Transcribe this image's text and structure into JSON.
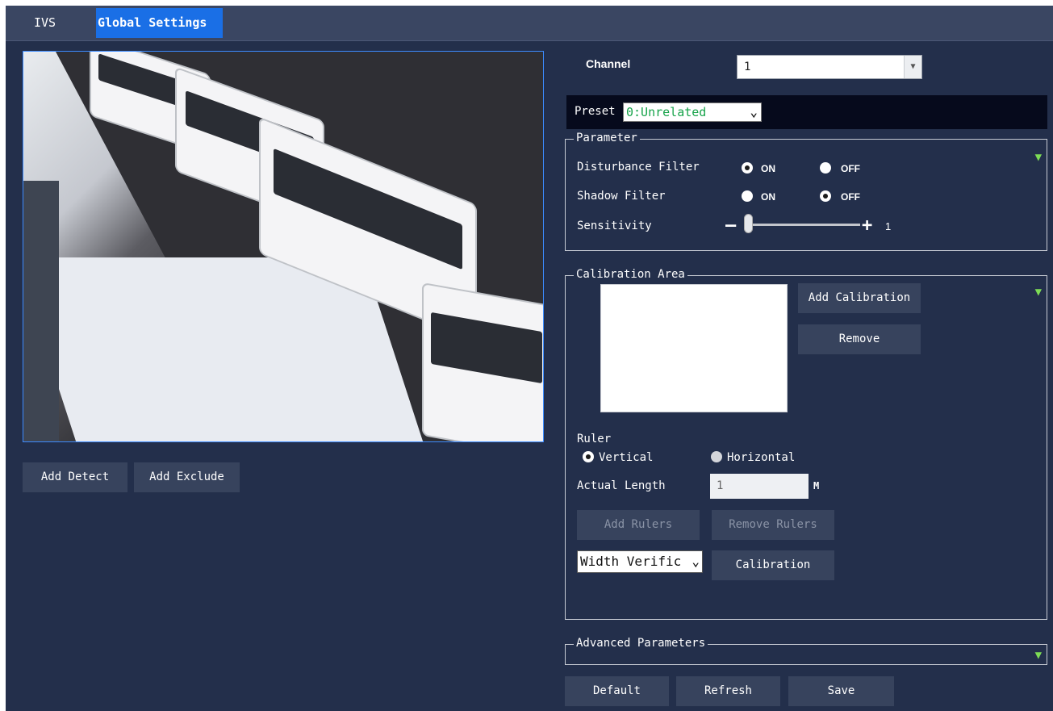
{
  "tabs": [
    {
      "label": "IVS"
    },
    {
      "label": "Global Settings"
    }
  ],
  "video": {
    "buttons": {
      "add_detect": "Add Detect",
      "add_exclude": "Add Exclude"
    }
  },
  "channel": {
    "label": "Channel",
    "value": "1"
  },
  "preset": {
    "label": "Preset",
    "value": "0:Unrelated"
  },
  "parameter": {
    "legend": "Parameter",
    "disturbance_filter": {
      "label": "Disturbance Filter",
      "on": "ON",
      "off": "OFF",
      "selected": "ON"
    },
    "shadow_filter": {
      "label": "Shadow Filter",
      "on": "ON",
      "off": "OFF",
      "selected": "OFF"
    },
    "sensitivity": {
      "label": "Sensitivity",
      "value": "1",
      "level": 1
    }
  },
  "calibration": {
    "legend": "Calibration Area",
    "add_calibration": "Add Calibration",
    "remove": "Remove",
    "ruler": {
      "label": "Ruler",
      "vertical": "Vertical",
      "horizontal": "Horizontal",
      "selected": "Vertical"
    },
    "actual_length": {
      "label": "Actual Length",
      "value": "1",
      "unit": "M"
    },
    "add_rulers": "Add Rulers",
    "remove_rulers": "Remove Rulers",
    "width_select": "Width Verific",
    "calibration_button": "Calibration"
  },
  "advanced": {
    "legend": "Advanced Parameters"
  },
  "footer": {
    "default": "Default",
    "refresh": "Refresh",
    "save": "Save"
  },
  "colors": {
    "accent": "#1a6fe6",
    "panel": "#232f4b",
    "button": "#37435d",
    "collapse": "#7ddc55"
  }
}
